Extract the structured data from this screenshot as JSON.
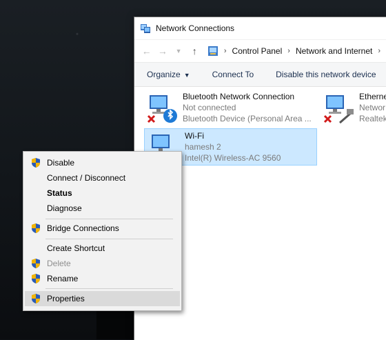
{
  "window": {
    "title": "Network Connections",
    "address": {
      "crumbs": [
        "Control Panel",
        "Network and Internet"
      ]
    },
    "commands": [
      {
        "label": "Organize",
        "has_dropdown": true
      },
      {
        "label": "Connect To"
      },
      {
        "label": "Disable this network device"
      }
    ]
  },
  "connections": [
    {
      "name": "Bluetooth Network Connection",
      "status": "Not connected",
      "device": "Bluetooth Device (Personal Area ...",
      "icon": "bluetooth-network-icon"
    },
    {
      "name": "Etherne",
      "status": "Networ",
      "device": "Realtek",
      "icon": "ethernet-network-icon"
    },
    {
      "name": "Wi-Fi",
      "status": "hamesh 2",
      "device": "Intel(R) Wireless-AC 9560",
      "icon": "wifi-network-icon",
      "selected": true
    }
  ],
  "context_menu": {
    "items": [
      {
        "label": "Disable",
        "shield": true
      },
      {
        "label": "Connect / Disconnect"
      },
      {
        "label": "Status",
        "bold": true
      },
      {
        "label": "Diagnose"
      },
      {
        "label": "Bridge Connections",
        "shield": true
      },
      {
        "label": "Create Shortcut"
      },
      {
        "label": "Delete",
        "shield": true,
        "disabled": true
      },
      {
        "label": "Rename",
        "shield": true
      },
      {
        "label": "Properties",
        "shield": true,
        "highlighted": true
      }
    ]
  },
  "colors": {
    "selection_bg": "#cce8ff",
    "selection_border": "#99d1ff",
    "menu_bg": "#f2f2f2",
    "menu_hover": "#dadada",
    "command_text": "#1b2f4f"
  }
}
